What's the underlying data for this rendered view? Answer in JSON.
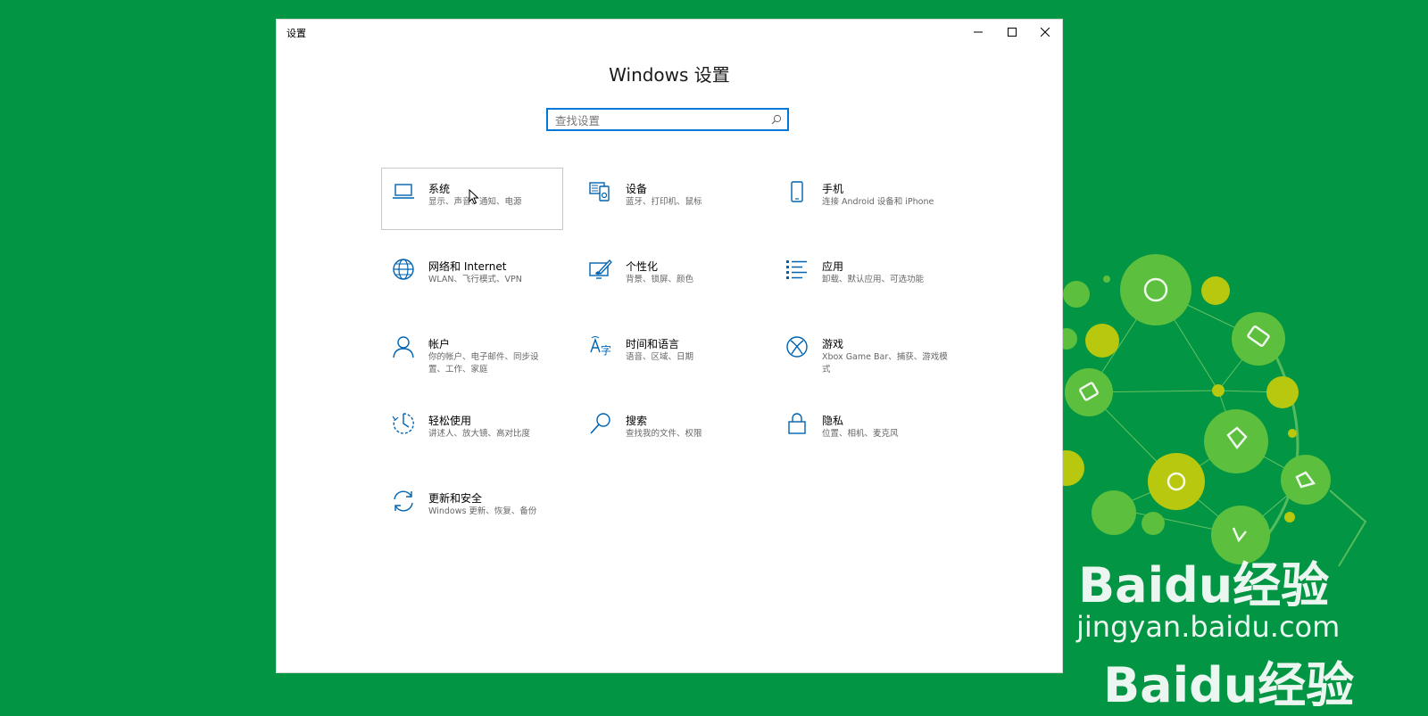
{
  "window": {
    "title": "设置",
    "heading": "Windows 设置"
  },
  "search": {
    "placeholder": "查找设置",
    "value": ""
  },
  "tiles": [
    {
      "name": "系统",
      "desc": "显示、声音、通知、电源",
      "icon": "laptop-icon"
    },
    {
      "name": "设备",
      "desc": "蓝牙、打印机、鼠标",
      "icon": "devices-icon"
    },
    {
      "name": "手机",
      "desc": "连接 Android 设备和 iPhone",
      "icon": "phone-icon"
    },
    {
      "name": "网络和 Internet",
      "desc": "WLAN、飞行模式、VPN",
      "icon": "globe-icon"
    },
    {
      "name": "个性化",
      "desc": "背景、锁屏、颜色",
      "icon": "paintbrush-icon"
    },
    {
      "name": "应用",
      "desc": "卸载、默认应用、可选功能",
      "icon": "apps-list-icon"
    },
    {
      "name": "帐户",
      "desc": "你的帐户、电子邮件、同步设置、工作、家庭",
      "icon": "person-icon"
    },
    {
      "name": "时间和语言",
      "desc": "语音、区域、日期",
      "icon": "time-language-icon"
    },
    {
      "name": "游戏",
      "desc": "Xbox Game Bar、捕获、游戏模式",
      "icon": "xbox-icon"
    },
    {
      "name": "轻松使用",
      "desc": "讲述人、放大镜、高对比度",
      "icon": "ease-of-access-icon"
    },
    {
      "name": "搜索",
      "desc": "查找我的文件、权限",
      "icon": "magnifier-icon"
    },
    {
      "name": "隐私",
      "desc": "位置、相机、麦克风",
      "icon": "lock-icon"
    },
    {
      "name": "更新和安全",
      "desc": "Windows 更新、恢复、备份",
      "icon": "sync-icon"
    }
  ],
  "watermark": {
    "logo": "Baidu经验",
    "url": "jingyan.baidu.com"
  },
  "colors": {
    "background": "#029543",
    "accent": "#0078d7",
    "art_green": "#5cbf3e",
    "art_yellow": "#b8c80e"
  }
}
